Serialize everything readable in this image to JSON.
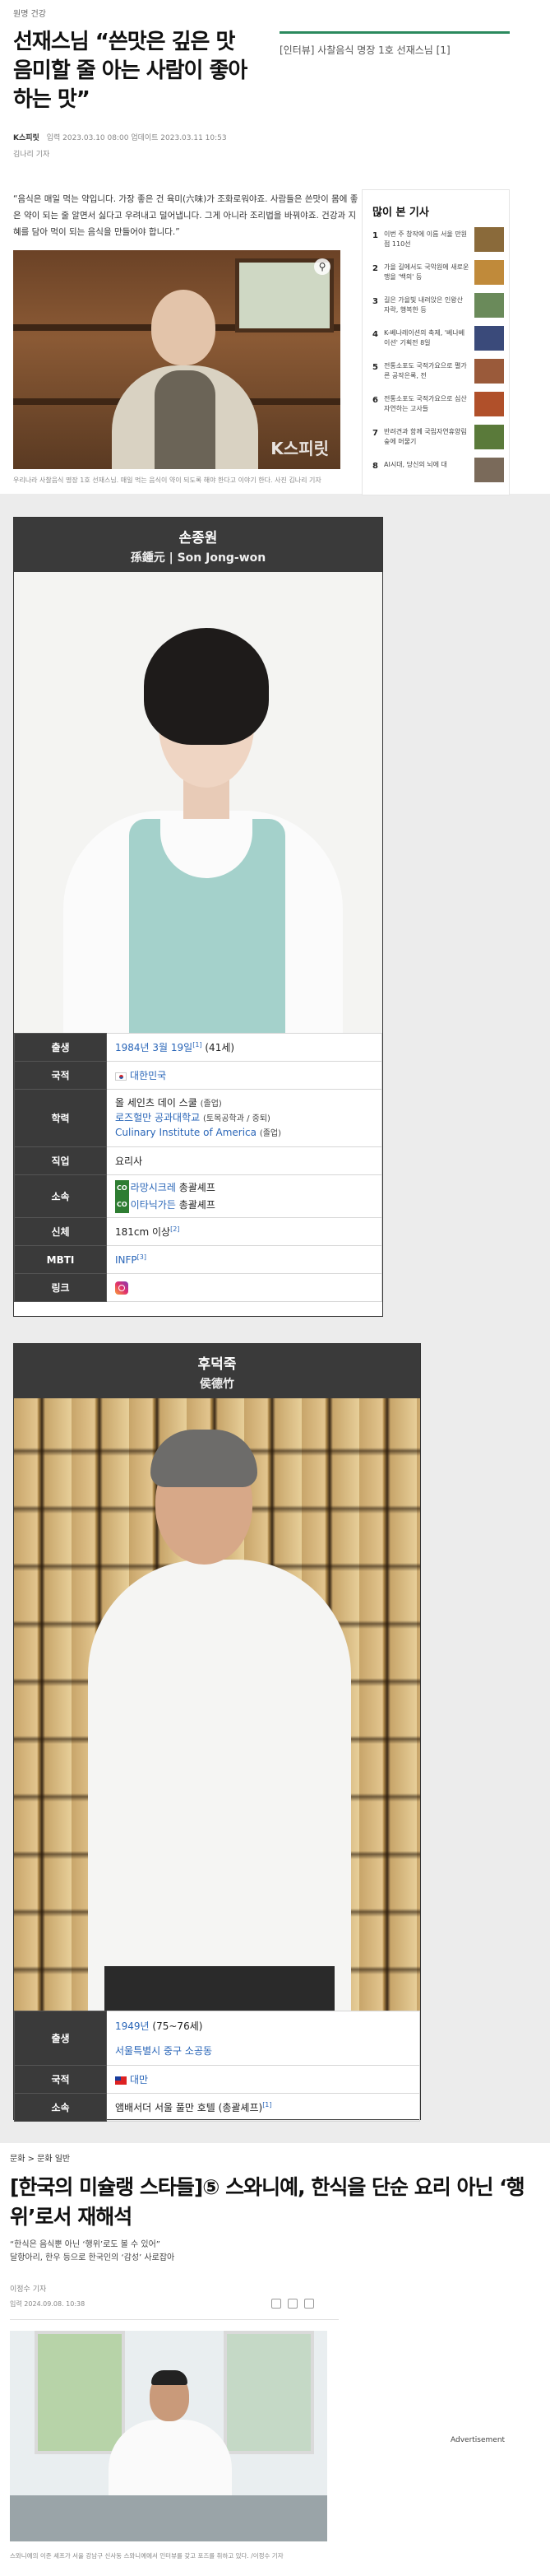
{
  "article1": {
    "category": "원명 건강",
    "title": "선재스님 “쓴맛은 깊은 맛 음미할 줄 아는 사람이 좋아하는 맛”",
    "related": "[인터뷰] 사찰음식 명장 1호 선재스님 [1]",
    "publisher": "K스피릿",
    "byline_meta": "입력 2023.03.10 08:00   업데이트 2023.03.11 10:53",
    "author": "김나리 기자",
    "lead": "“음식은 매일 먹는 약입니다. 가장 좋은 건 육미(六味)가 조화로워야죠. 사람들은 쓴맛이 몸에 좋은 약이 되는 줄 알면서 싫다고 우려내고 덜어냅니다. 그게 아니라 조리법을 바꿔야죠. 건강과 지혜를 담아 먹이 되는 음식을 만들어야 합니다.”",
    "photo_watermark": "K스피릿",
    "caption": "우리나라 사찰음식 명장 1호 선재스님. 매일 먹는 음식이 약이 되도록 해야 한다고 이야기 한다. 사진 김나리 기자"
  },
  "popular": {
    "title": "많이 본 기사",
    "items": [
      {
        "num": "1",
        "text": "이번 주 창작에 이름 서울 만원점 110선",
        "color": "#8a6a3a"
      },
      {
        "num": "2",
        "text": "가을 길에서도 국악원에 새로운 맹을 '백의' 등",
        "color": "#c08a3a"
      },
      {
        "num": "3",
        "text": "길은 가을빛 내려앉은 인왕산 자락, 행복한 등",
        "color": "#6a8a5a"
      },
      {
        "num": "4",
        "text": "K-베나레이션의 축제, '베나베이션' 기획전 8일",
        "color": "#3a4a7a"
      },
      {
        "num": "5",
        "text": "전통소포도 국적가요으로 펼가른 공작은록, 전",
        "color": "#9a5a3a"
      },
      {
        "num": "6",
        "text": "전통소포도 국적가요으로 심산자연하는 고사들",
        "color": "#b0502a"
      },
      {
        "num": "7",
        "text": "반려견과 함께 국립자연휴양림 숲에 머물기",
        "color": "#5a7a3a"
      },
      {
        "num": "8",
        "text": "AI시대, 당신의 뇌에 대",
        "color": "#7a6a5a"
      }
    ]
  },
  "wiki1": {
    "name_ko": "손종원",
    "name_alt": "孫鍾元 | Son Jong-won",
    "labels": {
      "birth": "출생",
      "nationality": "국적",
      "education": "학력",
      "job": "직업",
      "affiliation": "소속",
      "body": "신체",
      "mbti": "MBTI",
      "link": "링크"
    },
    "birth_date": "1984년 3월 19일",
    "birth_ref": "[1]",
    "birth_age": "(41세)",
    "nationality": "대한민국",
    "edu1_name": "올 세인츠 데이 스쿨",
    "edu1_note": "(졸업)",
    "edu2_name": "로즈헐만 공과대학교",
    "edu2_note": "(토목공학과 / 중퇴)",
    "edu3_name": "Culinary Institute of America",
    "edu3_note": "(졸업)",
    "job": "요리사",
    "aff_badge": "CO",
    "aff1_name": "라망시크레",
    "aff1_role": "총괄셰프",
    "aff2_name": "이타닉가든",
    "aff2_role": "총괄셰프",
    "body": "181cm 이상",
    "body_ref": "[2]",
    "mbti": "INFP",
    "mbti_ref": "[3]"
  },
  "wiki2": {
    "name_ko": "후덕죽",
    "name_alt": "侯德竹",
    "labels": {
      "birth": "출생",
      "nationality": "국적",
      "affiliation": "소속"
    },
    "birth_year": "1949년",
    "birth_age": "(75~76세)",
    "birth_place": "서울특별시 중구 소공동",
    "nationality": "대만",
    "affiliation": "앰배서더 서울 풀만 호텔 (총괄셰프)",
    "affiliation_ref": "[1]"
  },
  "article2": {
    "category": "문화 > 문화 일반",
    "title": "[한국의 미슐랭 스타들]⑤ 스와니예, 한식을 단순 요리 아닌 ‘행위’로서 재해석",
    "sub1": "“한식은 음식뿐 아닌 ‘행위’로도 볼 수 있어”",
    "sub2": "달항아리, 한우 등으로 한국인의 ‘감성’ 사로잡아",
    "author": "이정수 기자",
    "date": "입력 2024.09.08. 10:38",
    "caption": "스와니예의 이준 셰프가 서울 강남구 신사동 스와니예에서 인터뷰를 갖고 포즈를 취하고 있다. /이정수 기자",
    "ad": "Advertisement"
  },
  "colors": {
    "accent_green": "#2b8a5e",
    "link_blue": "#2a66b8",
    "infobox_header": "#3a3a3a"
  }
}
